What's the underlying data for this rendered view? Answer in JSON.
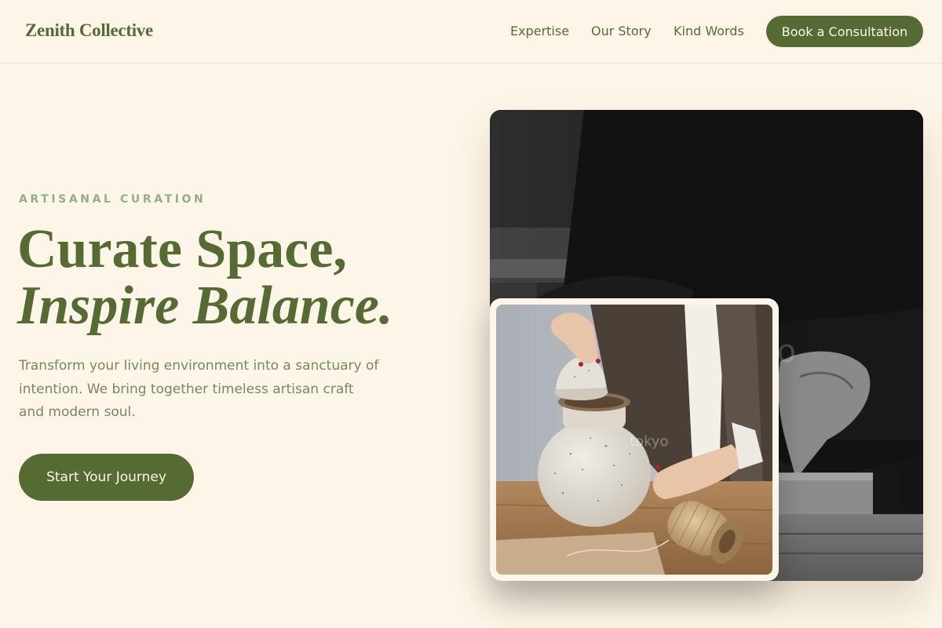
{
  "brand": {
    "name": "Zenith Collective"
  },
  "nav": {
    "items": [
      {
        "label": "Expertise"
      },
      {
        "label": "Our Story"
      },
      {
        "label": "Kind Words"
      }
    ],
    "cta_label": "Book a Consultation"
  },
  "hero": {
    "eyebrow": "ARTISANAL CURATION",
    "headline_line1": "Curate Space,",
    "headline_line2": "Inspire Balance.",
    "description": "Transform your living environment into a sanctuary of intention. We bring together timeless artisan craft and modern soul.",
    "cta_label": "Start Your Journey"
  },
  "images": {
    "main_watermark": "tokyo",
    "inset_watermark": "tokyo"
  },
  "colors": {
    "background": "#fdf5e7",
    "brand_green": "#566b34",
    "eyebrow_green": "#8fb083",
    "body_text": "#7c8660"
  }
}
